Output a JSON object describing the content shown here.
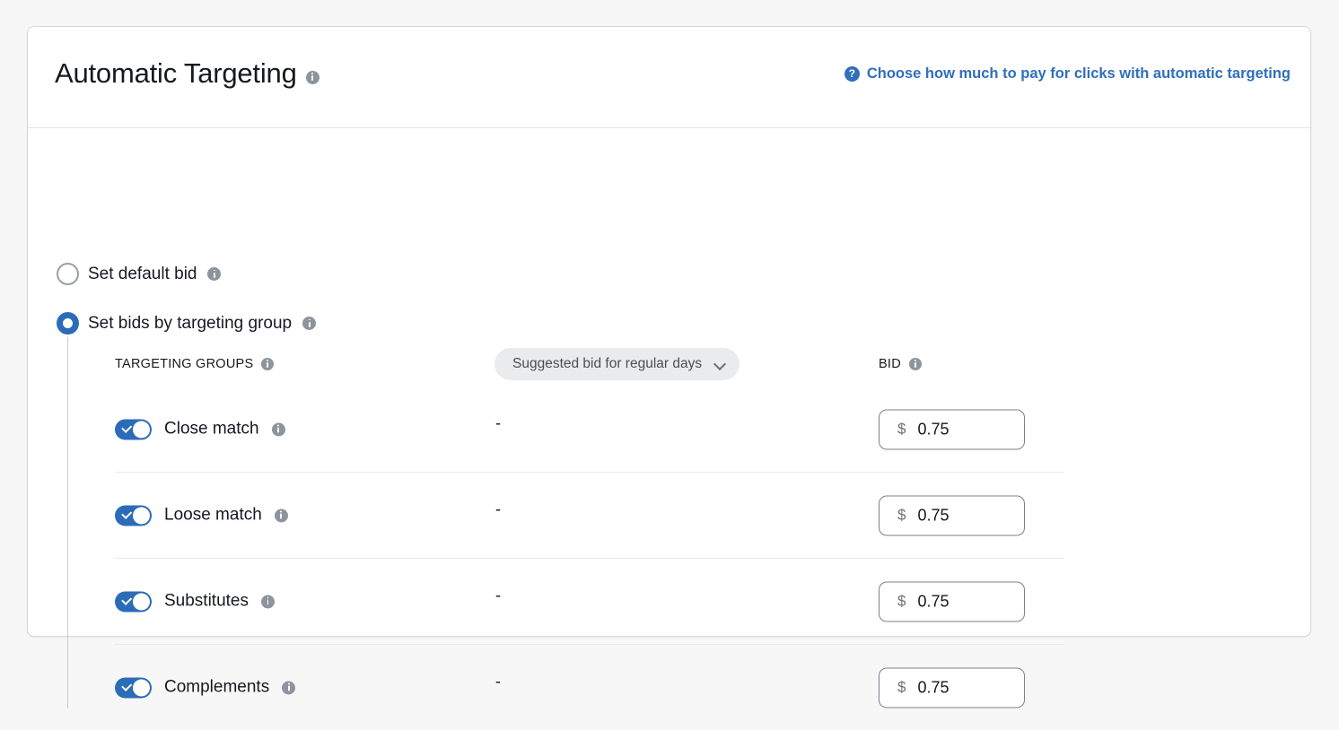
{
  "card": {
    "title": "Automatic Targeting",
    "title_info_icon": "info-icon",
    "header_link": {
      "icon": "question-circle-icon",
      "text": "Choose how much to pay for clicks with automatic targeting",
      "color": "#2f6fbb"
    }
  },
  "bid_mode": {
    "options": [
      {
        "label": "Set default bid",
        "selected": false,
        "info_icon": "info-icon"
      },
      {
        "label": "Set bids by targeting group",
        "selected": true,
        "info_icon": "info-icon"
      }
    ]
  },
  "table": {
    "headers": {
      "targeting_groups": "TARGETING GROUPS",
      "targeting_groups_info_icon": "info-icon",
      "suggested_bid_dropdown": {
        "value": "Suggested bid for regular days",
        "chevron_icon": "chevron-down-icon"
      },
      "bid": "BID",
      "bid_info_icon": "info-icon"
    },
    "rows": [
      {
        "label": "Close match",
        "enabled": true,
        "suggested": "-",
        "currency": "$",
        "bid": "0.75",
        "info_icon": "info-icon"
      },
      {
        "label": "Loose match",
        "enabled": true,
        "suggested": "-",
        "currency": "$",
        "bid": "0.75",
        "info_icon": "info-icon"
      },
      {
        "label": "Substitutes",
        "enabled": true,
        "suggested": "-",
        "currency": "$",
        "bid": "0.75",
        "info_icon": "info-icon"
      },
      {
        "label": "Complements",
        "enabled": true,
        "suggested": "-",
        "currency": "$",
        "bid": "0.75",
        "info_icon": "info-icon"
      }
    ]
  },
  "colors": {
    "accent_blue": "#2b6cb8",
    "link_blue": "#2f6fbb",
    "toggle_on": "#2b6cb8",
    "page_background": "#f7f7f7",
    "card_background": "#ffffff",
    "info_gray": "#8d949e"
  }
}
